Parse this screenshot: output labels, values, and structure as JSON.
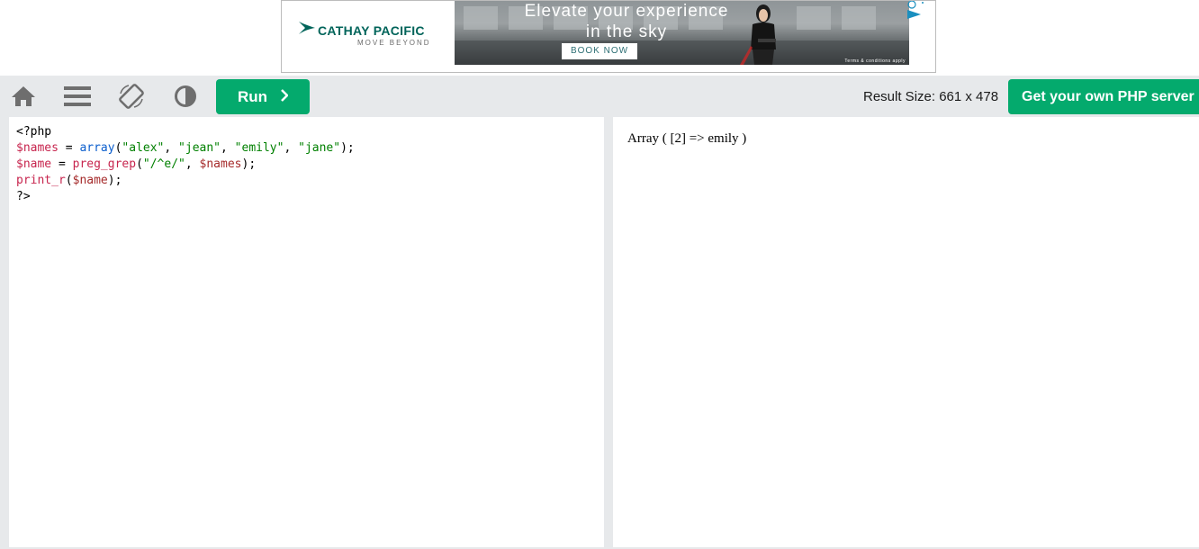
{
  "ad": {
    "brand": "CATHAY PACIFIC",
    "tagline": "MOVE BEYOND",
    "headline_line1": "Elevate your experience",
    "headline_line2": "in the sky",
    "cta": "BOOK NOW",
    "terms": "Terms & conditions apply",
    "accent_color": "#00645a"
  },
  "toolbar": {
    "icons": [
      "home-icon",
      "menu-icon",
      "rotate-icon",
      "contrast-icon"
    ],
    "run_label": "Run",
    "result_size_label": "Result Size: 661 x 478",
    "server_button_label": "Get your own PHP server",
    "button_color": "#04aa6d"
  },
  "editor": {
    "lines": [
      "<?php",
      "$names = array(\"alex\", \"jean\", \"emily\", \"jane\");",
      "$name = preg_grep(\"/^e/\", $names);",
      "print_r($name);",
      "?>"
    ],
    "tokens": {
      "open_tag": "<?php",
      "var_names": "$names",
      "eq": " = ",
      "fn_array": "array",
      "lp": "(",
      "s_alex": "\"alex\"",
      "s_jean": "\"jean\"",
      "s_emily": "\"emily\"",
      "s_jane": "\"jane\"",
      "comma": ", ",
      "rp_semi": ");",
      "var_name": "$name",
      "fn_preg": "preg_grep",
      "s_regex": "\"/^e/\"",
      "fn_print": "print_r",
      "close_tag": "?>"
    }
  },
  "result": {
    "output": "Array ( [2] => emily )"
  }
}
